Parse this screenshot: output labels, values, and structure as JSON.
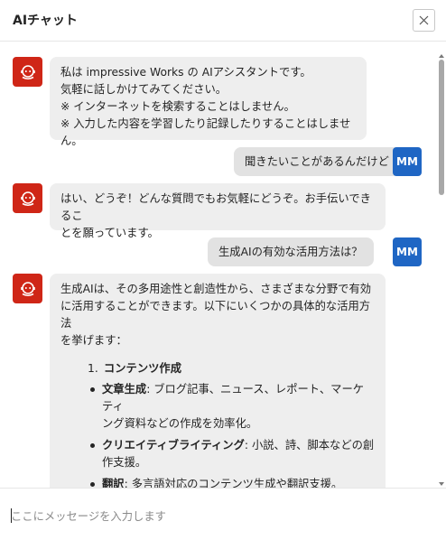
{
  "header": {
    "title": "AIチャット"
  },
  "messages": {
    "bot1": {
      "lines": [
        "私は impressive Works の AIアシスタントです。",
        "気軽に話しかけてみてください。",
        "※ インターネットを検索することはしません。",
        "※ 入力した内容を学習したり記録したりすることはしません。"
      ]
    },
    "user1": {
      "text": "聞きたいことがあるんだけど",
      "avatar": "MM"
    },
    "bot2": {
      "lines": [
        "はい、どうぞ！どんな質問でもお気軽にどうぞ。お手伝いできるこ",
        "とを願っています。"
      ]
    },
    "user2": {
      "text": "生成AIの有効な活用方法は？",
      "avatar": "MM"
    },
    "bot3": {
      "lines": [
        "生成AIは、その多用途性と創造性から、さまざまな分野で有効",
        "に活用することができます。以下にいくつかの具体的な活用方法",
        "を挙げます："
      ],
      "list": {
        "number": "1.",
        "heading": "コンテンツ作成",
        "items": [
          {
            "term": "文章生成",
            "desc_lines": [
              ": ブログ記事、ニュース、レポート、マーケティ",
              "ング資料などの作成を効率化。"
            ]
          },
          {
            "term": "クリエイティブライティング",
            "desc_lines": [
              ": 小説、詩、脚本などの創",
              "作支援。"
            ]
          },
          {
            "term": "翻訳",
            "desc_lines": [
              ": 多言語対応のコンテンツ生成や翻訳支援。"
            ]
          }
        ]
      }
    }
  },
  "input": {
    "placeholder": "ここにメッセージを入力します"
  },
  "icons": {
    "bot_avatar": "robot-icon",
    "close": "close-icon"
  },
  "colors": {
    "bot_avatar_bg": "#cf2617",
    "user_avatar_bg": "#1f66c4"
  }
}
